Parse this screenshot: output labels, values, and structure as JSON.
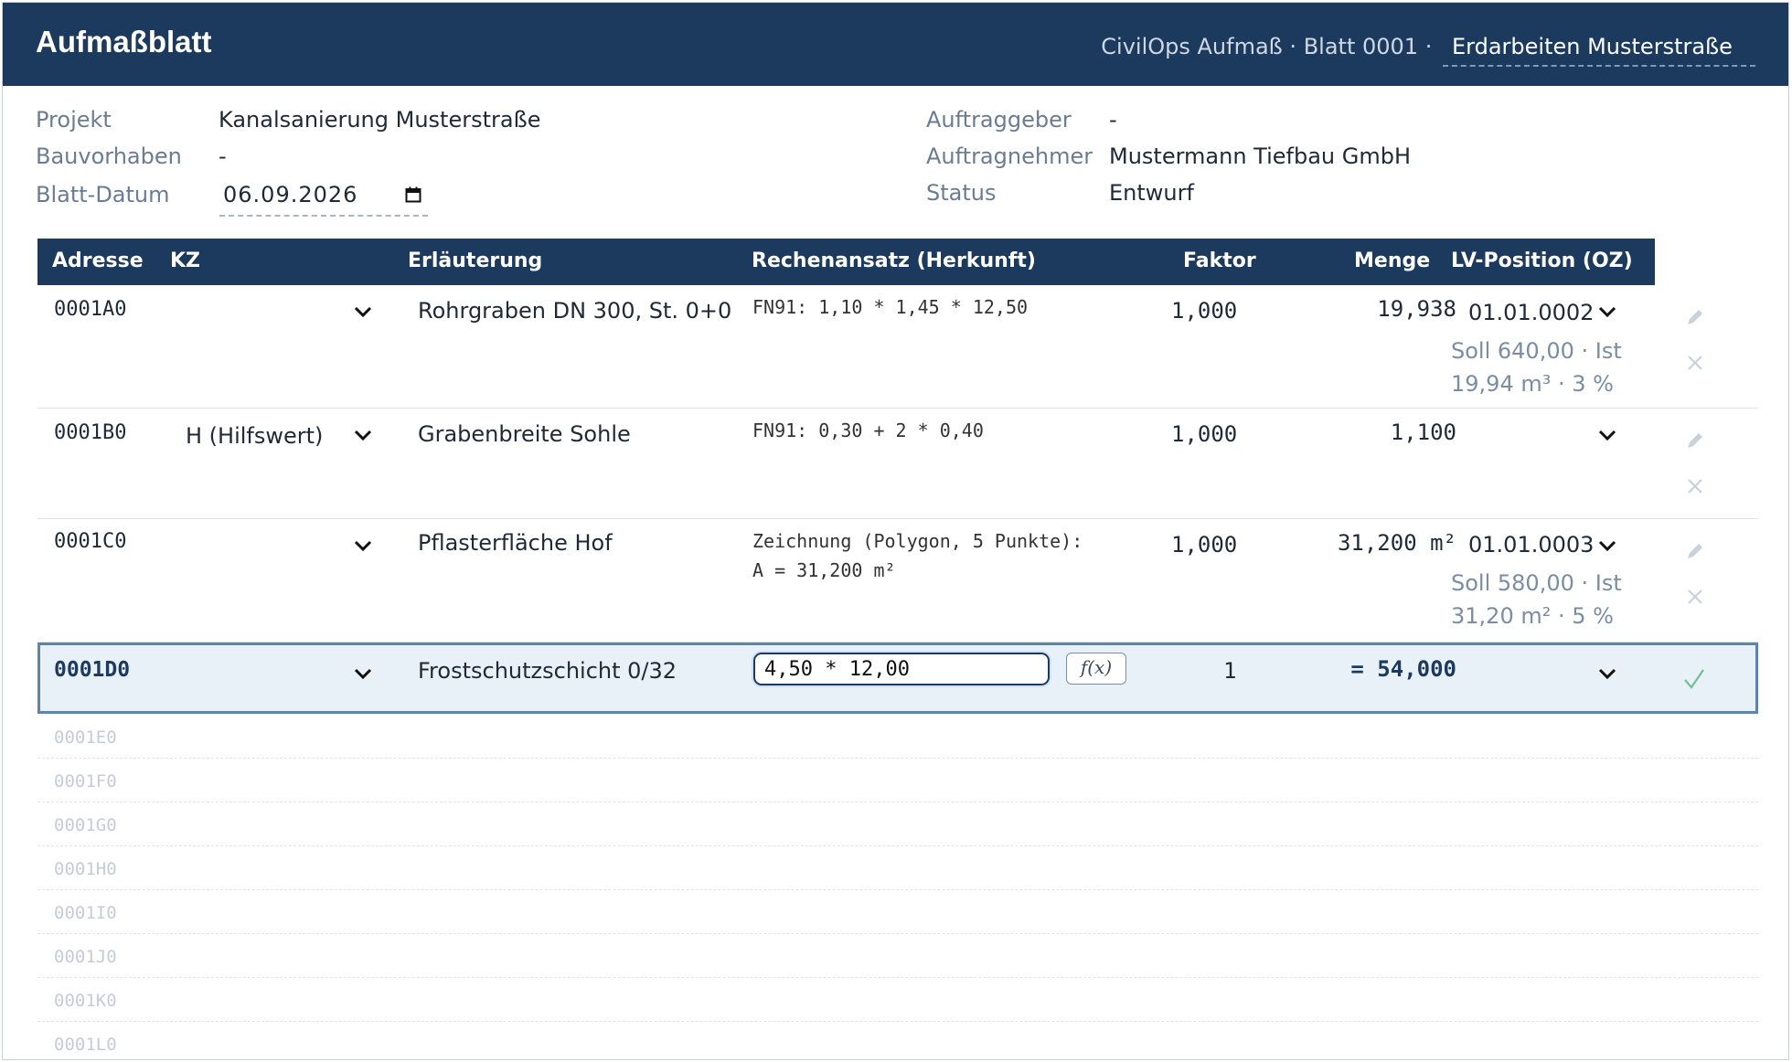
{
  "header": {
    "title": "Aufmaßblatt",
    "app_name": "CivilOps Aufmaß",
    "sheet_ref": "Blatt 0001",
    "separator": "·",
    "sheet_name": "Erdarbeiten Musterstraße"
  },
  "meta": {
    "projekt_label": "Projekt",
    "projekt": "Kanalsanierung Musterstraße",
    "bauvorhaben_label": "Bauvorhaben",
    "bauvorhaben": "-",
    "datum_label": "Blatt-Datum",
    "datum": "06.09.2026",
    "auftraggeber_label": "Auftraggeber",
    "auftraggeber": "-",
    "auftragnehmer_label": "Auftragnehmer",
    "auftragnehmer": "Mustermann Tiefbau GmbH",
    "status_label": "Status",
    "status": "Entwurf"
  },
  "columns": {
    "adresse": "Adresse",
    "kz": "KZ",
    "erlaeuterung": "Erläuterung",
    "rechenansatz": "Rechenansatz (Herkunft)",
    "faktor": "Faktor",
    "menge": "Menge",
    "lv_position": "LV-Position (OZ)"
  },
  "rows": [
    {
      "adresse": "0001A0",
      "kz": "",
      "erlaeuterung": "Rohrgraben DN 300, St. 0+0",
      "rechenansatz": "FN91: 1,10 * 1,45 * 12,50",
      "faktor": "1,000",
      "menge": "19,938",
      "oz": "01.01.0002",
      "soll_line1": "Soll 640,00 · Ist",
      "soll_line2": "19,94 m³ · 3 %"
    },
    {
      "adresse": "0001B0",
      "kz": "H (Hilfswert)",
      "erlaeuterung": "Grabenbreite Sohle",
      "rechenansatz": "FN91: 0,30 + 2 * 0,40",
      "faktor": "1,000",
      "menge": "1,100",
      "oz": ""
    },
    {
      "adresse": "0001C0",
      "kz": "",
      "erlaeuterung": "Pflasterfläche Hof",
      "rechenansatz_line1": "Zeichnung (Polygon, 5 Punkte):",
      "rechenansatz_line2": "A = 31,200 m²",
      "faktor": "1,000",
      "menge": "31,200 m²",
      "oz": "01.01.0003",
      "soll_line1": "Soll 580,00 · Ist",
      "soll_line2": "31,20 m² · 5 %"
    }
  ],
  "active_row": {
    "adresse": "0001D0",
    "kz": "",
    "erlaeuterung": "Frostschutzschicht 0/32",
    "formula": "4,50 * 12,00",
    "fx_label": "f(x)",
    "faktor": "1",
    "menge": "= 54,000",
    "oz": ""
  },
  "empty_rows": [
    "0001E0",
    "0001F0",
    "0001G0",
    "0001H0",
    "0001I0",
    "0001J0",
    "0001K0",
    "0001L0"
  ],
  "colors": {
    "header_bg": "#1b3a5e",
    "active_row_bg": "#e8f0f8",
    "active_row_border": "#5f83ab",
    "muted_text": "#7a8da3",
    "confirm_green": "#6fbf8f"
  }
}
